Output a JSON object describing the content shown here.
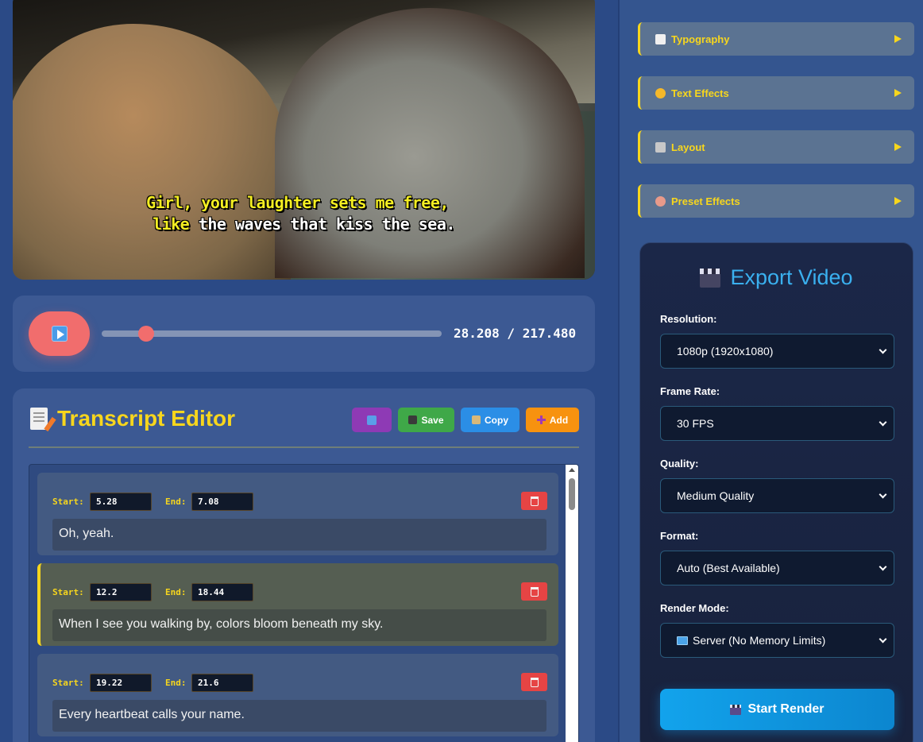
{
  "video": {
    "caption_line1": "Girl, your laughter sets me free,",
    "caption_line2_highlight": "like",
    "caption_line2_rest": "the waves that kiss the sea."
  },
  "player": {
    "current_time": "28.208",
    "duration": "217.480",
    "time_display": "28.208 / 217.480",
    "progress": 0.1297
  },
  "transcript_editor": {
    "title": "Transcript Editor",
    "toolbar": {
      "refresh_icon": "refresh-icon",
      "save_label": "Save",
      "copy_label": "Copy",
      "add_label": "Add"
    },
    "start_label": "Start:",
    "end_label": "End:",
    "segments": [
      {
        "start": "5.28",
        "end": "7.08",
        "text": "Oh, yeah.",
        "active": false
      },
      {
        "start": "12.2",
        "end": "18.44",
        "text": "When I see you walking by, colors bloom beneath my sky.",
        "active": true
      },
      {
        "start": "19.22",
        "end": "21.6",
        "text": "Every heartbeat calls your name.",
        "active": false
      }
    ]
  },
  "accordions": [
    {
      "label": "Typography",
      "icon": "document-icon",
      "color": "#f0f0f0"
    },
    {
      "label": "Text Effects",
      "icon": "sparkles-icon",
      "color": "#f5b82a"
    },
    {
      "label": "Layout",
      "icon": "triangle-ruler-icon",
      "color": "#c8c8c8"
    },
    {
      "label": "Preset Effects",
      "icon": "palette-icon",
      "color": "#e89a8a"
    }
  ],
  "export": {
    "title": "Export Video",
    "resolution_label": "Resolution:",
    "resolution_value": "1080p (1920x1080)",
    "frame_rate_label": "Frame Rate:",
    "frame_rate_value": "30 FPS",
    "quality_label": "Quality:",
    "quality_value": "Medium Quality",
    "format_label": "Format:",
    "format_value": "Auto (Best Available)",
    "render_mode_label": "Render Mode:",
    "render_mode_value": "Server (No Memory Limits)",
    "start_render_label": "Start Render"
  },
  "colors": {
    "accent_yellow": "#f7d61d",
    "accent_blue": "#3ab0ef",
    "play_red": "#f16d6d",
    "delete_red": "#e64444"
  }
}
